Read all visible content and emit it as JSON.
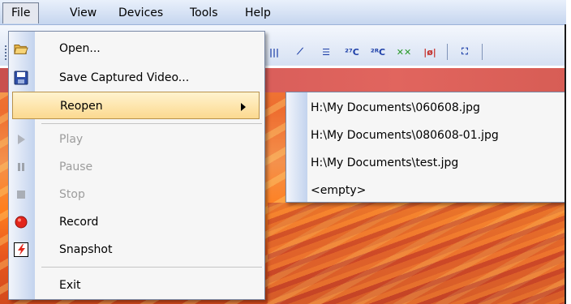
{
  "menubar": {
    "items": [
      "File",
      "View",
      "Devices",
      "Tools",
      "Help"
    ]
  },
  "file_menu": {
    "items": [
      {
        "label": "Open...",
        "icon": "folder-open-icon",
        "enabled": true
      },
      {
        "label": "Save Captured Video...",
        "icon": "floppy-disk-icon",
        "enabled": true
      },
      {
        "label": "Reopen",
        "icon": "",
        "enabled": true,
        "submenu": true,
        "highlighted": true
      },
      {
        "label": "Play",
        "icon": "play-icon",
        "enabled": false
      },
      {
        "label": "Pause",
        "icon": "pause-icon",
        "enabled": false
      },
      {
        "label": "Stop",
        "icon": "stop-icon",
        "enabled": false
      },
      {
        "label": "Record",
        "icon": "record-icon",
        "enabled": true
      },
      {
        "label": "Snapshot",
        "icon": "snapshot-icon",
        "enabled": true
      },
      {
        "label": "Exit",
        "icon": "",
        "enabled": true
      }
    ]
  },
  "reopen_submenu": {
    "items": [
      "H:\\My Documents\\060608.jpg",
      "H:\\My Documents\\080608-01.jpg",
      "H:\\My Documents\\test.jpg",
      "<empty>"
    ]
  },
  "toolbar": {
    "icons": [
      "histogram-icon",
      "line-profile-icon",
      "isotherm-icon",
      "temperature-c-icon",
      "temperature-pointer-icon",
      "clear-markers-icon",
      "emissivity-icon",
      "fullscreen-icon"
    ],
    "glyphs": [
      "|||",
      "⟋",
      "☰",
      "²⁷C",
      "²ᴿC",
      "✕✕",
      "|ø|",
      "⛶"
    ]
  },
  "colors": {
    "menu_highlight": "#fcd98f",
    "record_red": "#e3261c",
    "menubar_bg": "#c6d6ef"
  }
}
